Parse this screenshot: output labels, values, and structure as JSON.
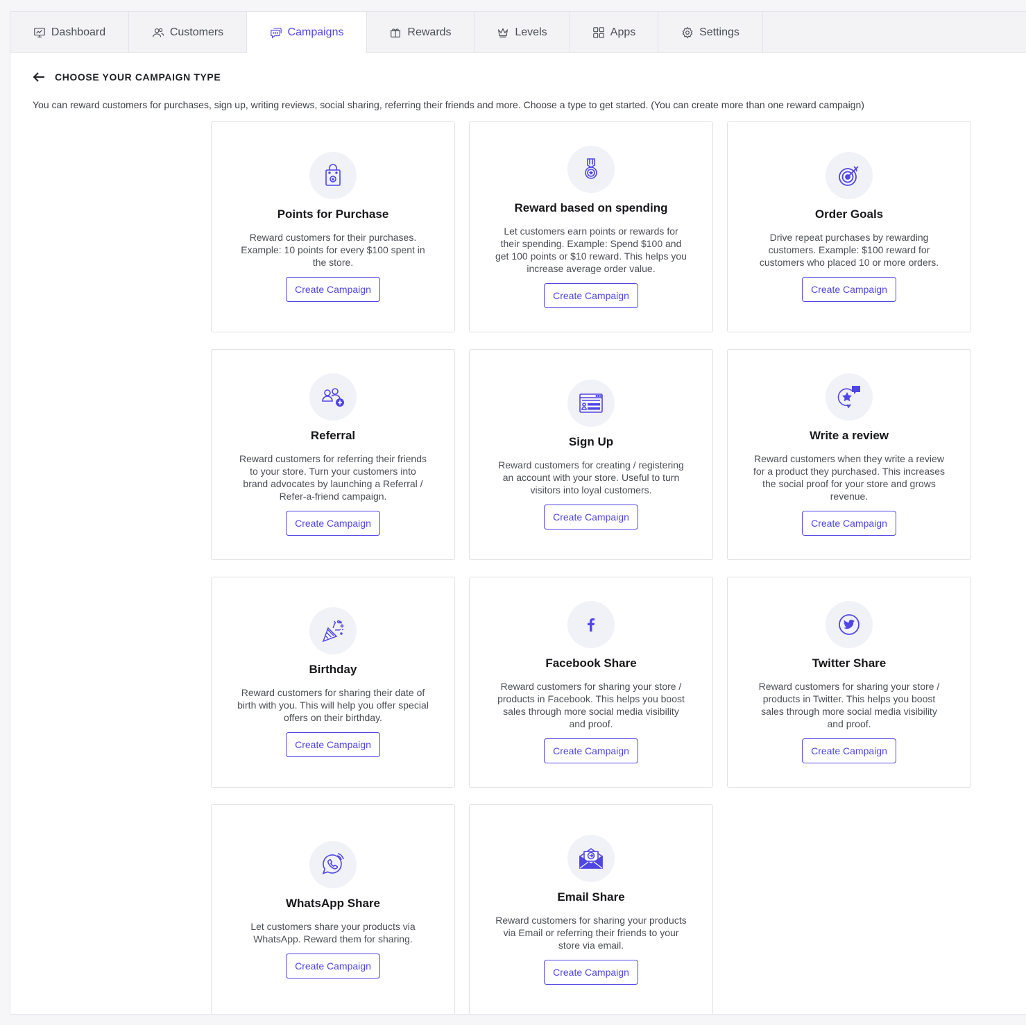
{
  "tabs": [
    {
      "label": "Dashboard",
      "icon": "dashboard-icon"
    },
    {
      "label": "Customers",
      "icon": "customers-icon"
    },
    {
      "label": "Campaigns",
      "icon": "campaigns-icon",
      "active": true
    },
    {
      "label": "Rewards",
      "icon": "rewards-icon"
    },
    {
      "label": "Levels",
      "icon": "crown-icon"
    },
    {
      "label": "Apps",
      "icon": "apps-grid-icon"
    },
    {
      "label": "Settings",
      "icon": "gear-icon"
    }
  ],
  "header": {
    "title": "CHOOSE YOUR CAMPAIGN TYPE",
    "subtitle": "You can reward customers for purchases, sign up, writing reviews, social sharing, referring their friends and more. Choose a type to get started. (You can create more than one reward campaign)"
  },
  "accent_color": "#5046e5",
  "cards": [
    {
      "title": "Points for Purchase",
      "description": "Reward customers for their purchases. Example: 10 points for every $100 spent in the store.",
      "button": "Create Campaign",
      "icon": "shopping-bag-icon"
    },
    {
      "title": "Reward based on spending",
      "description": "Let customers earn points or rewards for their spending. Example: Spend $100 and get 100 points or $10 reward. This helps you increase average order value.",
      "button": "Create Campaign",
      "icon": "medal-icon"
    },
    {
      "title": "Order Goals",
      "description": "Drive repeat purchases by rewarding customers. Example: $100 reward for customers who placed 10 or more orders.",
      "button": "Create Campaign",
      "icon": "target-icon"
    },
    {
      "title": "Referral",
      "description": "Reward customers for referring their friends to your store. Turn your customers into brand advocates by launching a Referral / Refer-a-friend campaign.",
      "button": "Create Campaign",
      "icon": "referral-users-icon"
    },
    {
      "title": "Sign Up",
      "description": "Reward customers for creating / registering an account with your store. Useful to turn visitors into loyal customers.",
      "button": "Create Campaign",
      "icon": "signup-form-icon"
    },
    {
      "title": "Write a review",
      "description": "Reward customers when they write a review for a product they purchased. This increases the social proof for your store and grows revenue.",
      "button": "Create Campaign",
      "icon": "review-star-icon"
    },
    {
      "title": "Birthday",
      "description": "Reward customers for sharing their date of birth with you. This will help you offer special offers on their birthday.",
      "button": "Create Campaign",
      "icon": "party-popper-icon"
    },
    {
      "title": "Facebook Share",
      "description": "Reward customers for sharing your store / products in Facebook. This helps you boost sales through more social media visibility and proof.",
      "button": "Create Campaign",
      "icon": "facebook-icon"
    },
    {
      "title": "Twitter Share",
      "description": "Reward customers for sharing your store / products in Twitter. This helps you boost sales through more social media visibility and proof.",
      "button": "Create Campaign",
      "icon": "twitter-icon"
    },
    {
      "title": "WhatsApp Share",
      "description": "Let customers share your products via WhatsApp. Reward them for sharing.",
      "button": "Create Campaign",
      "icon": "whatsapp-icon"
    },
    {
      "title": "Email Share",
      "description": "Reward customers for sharing your products via Email or referring their friends to your store via email.",
      "button": "Create Campaign",
      "icon": "email-icon"
    }
  ]
}
